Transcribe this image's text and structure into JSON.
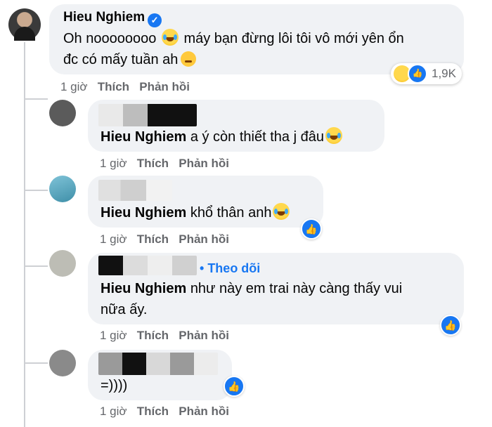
{
  "main_comment": {
    "author": "Hieu Nghiem",
    "text_line1": "Oh noooooooo",
    "text_line1b": "máy bạn đừng lôi tôi vô mới yên ổn",
    "text_line2": "đc có mấy tuần ah",
    "reaction_count": "1,9K",
    "time": "1 giờ",
    "like_label": "Thích",
    "reply_label": "Phản hồi"
  },
  "replies": [
    {
      "mention": "Hieu Nghiem",
      "text": "a ý còn thiết tha j đâu",
      "time": "1 giờ",
      "like_label": "Thích",
      "reply_label": "Phản hồi"
    },
    {
      "mention": "Hieu Nghiem",
      "text": "khổ thân anh",
      "time": "1 giờ",
      "like_label": "Thích",
      "reply_label": "Phản hồi"
    },
    {
      "follow_label": "Theo dõi",
      "mention": "Hieu Nghiem",
      "text_line1": "như này em trai này càng thấy vui",
      "text_line2": "nữa ấy.",
      "time": "1 giờ",
      "like_label": "Thích",
      "reply_label": "Phản hồi"
    },
    {
      "text": "=))))",
      "time": "1 giờ",
      "like_label": "Thích",
      "reply_label": "Phản hồi"
    }
  ],
  "icons": {
    "verified": "verified-badge-icon",
    "like": "like-thumb-icon",
    "haha": "haha-emoji-icon"
  },
  "colors": {
    "accent": "#1877f2",
    "bubble": "#f0f2f5",
    "meta": "#65676b"
  }
}
